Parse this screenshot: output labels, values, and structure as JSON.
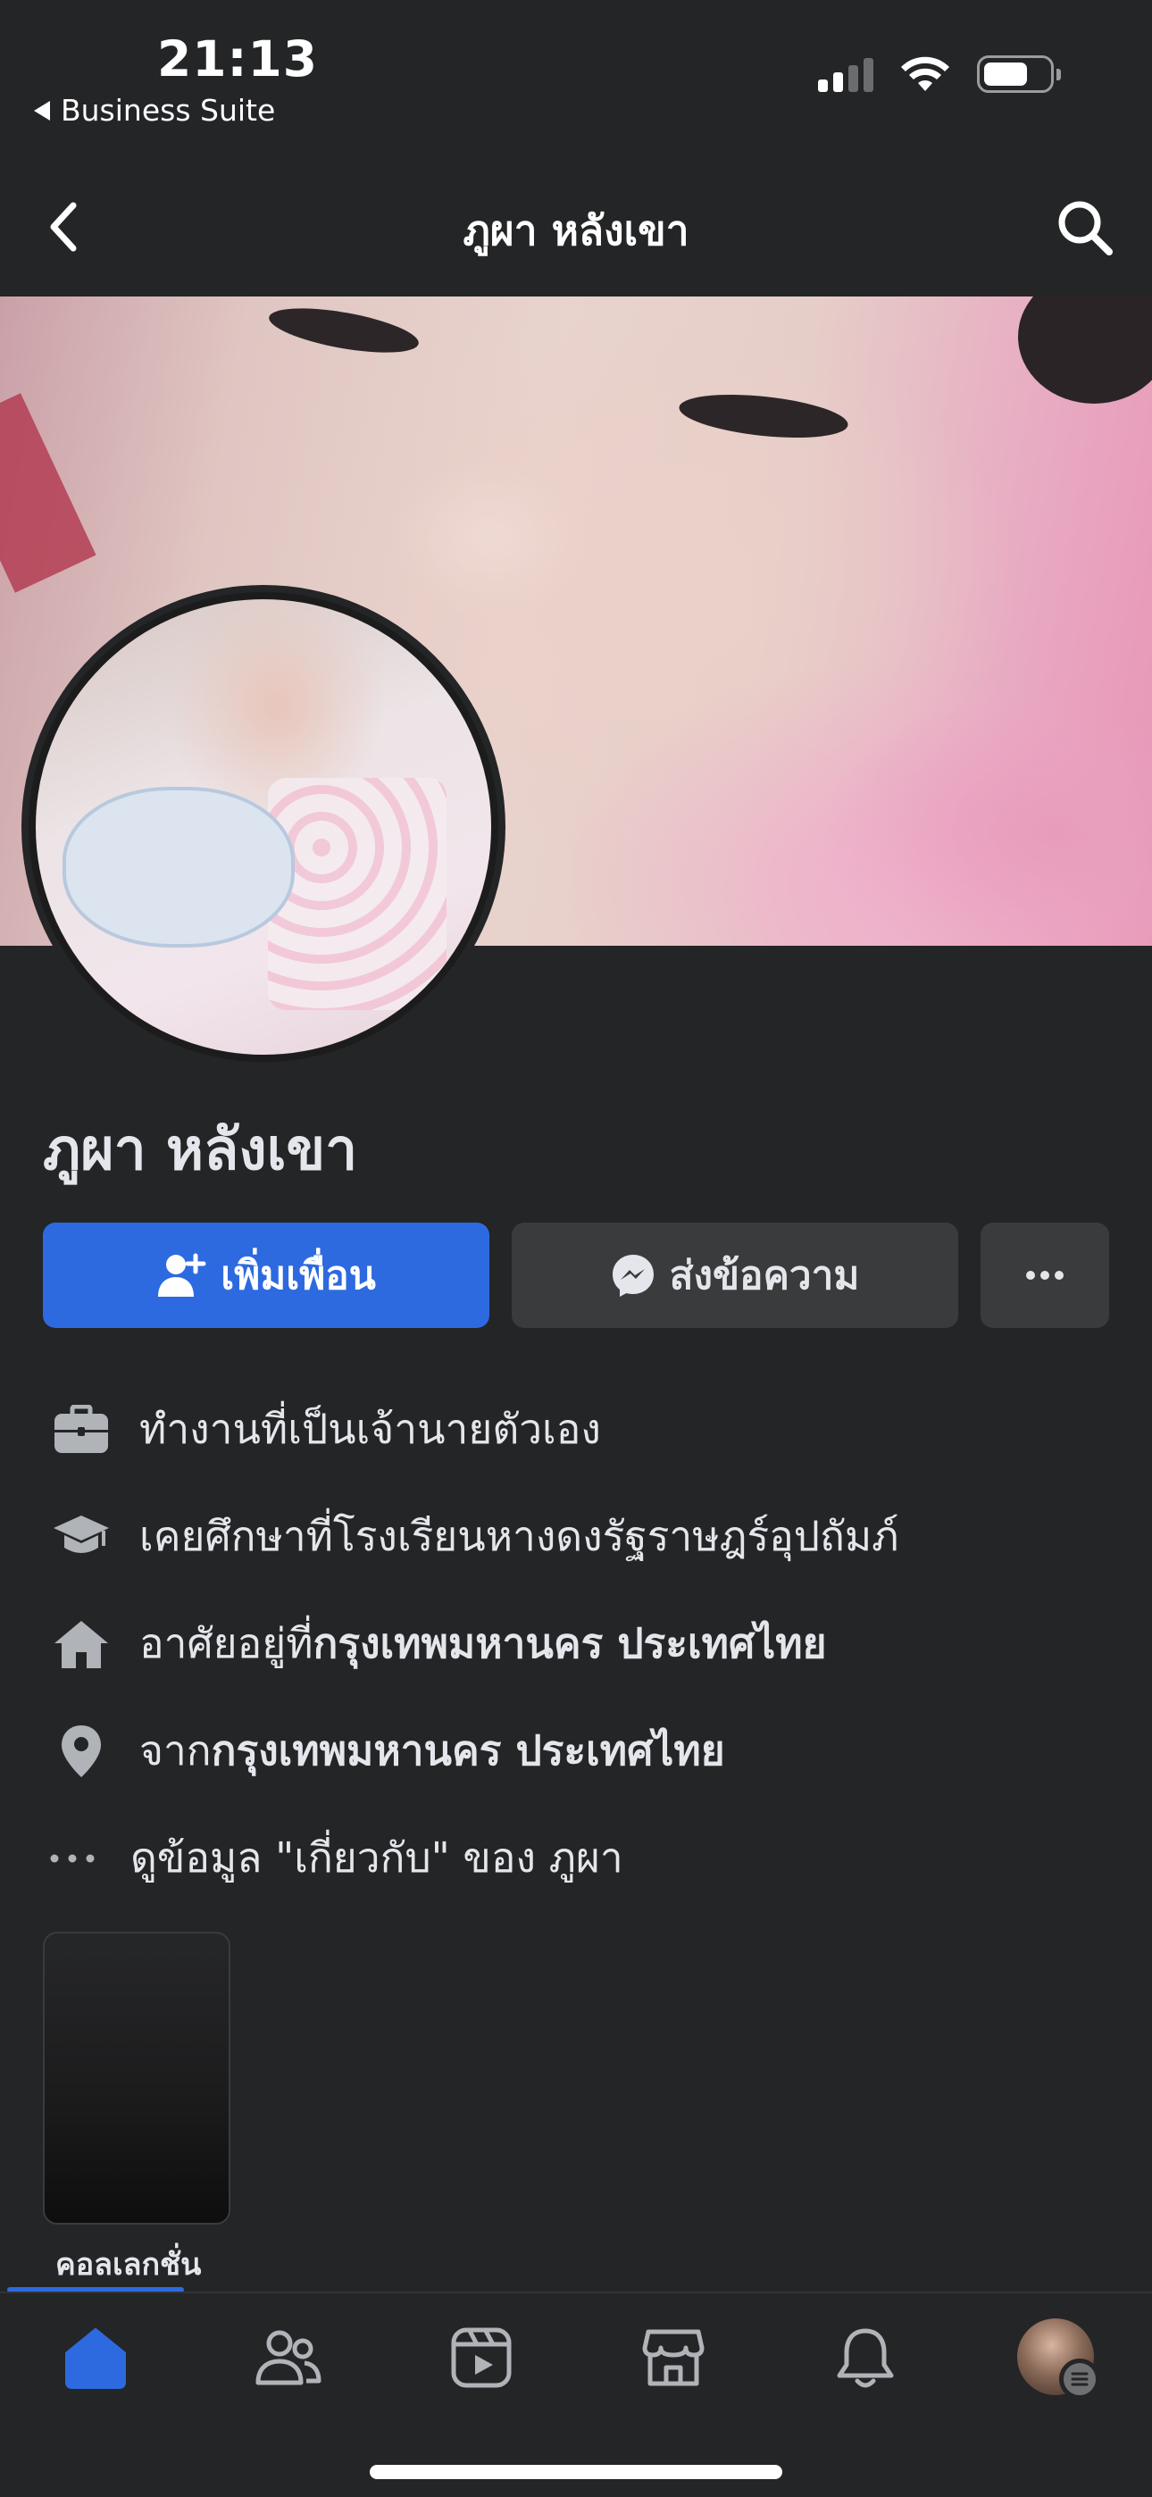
{
  "status_bar": {
    "time": "21:13",
    "back_app": "Business Suite",
    "icons": [
      "cellular-signal-icon",
      "wifi-icon",
      "battery-icon"
    ]
  },
  "nav": {
    "title": "ภูผา หลังเขา",
    "icons": [
      "chevron-left-icon",
      "search-icon"
    ]
  },
  "profile": {
    "name": "ภูผา หลังเขา"
  },
  "actions": {
    "add_friend": "เพิ่มเพื่อน",
    "message": "ส่งข้อความ",
    "more": "..."
  },
  "info": [
    {
      "icon": "briefcase-icon",
      "prefix": "ทำงานที่ ",
      "value": "เป็นเจ้านายตัวเอง",
      "value_bold": false
    },
    {
      "icon": "graduation-cap-icon",
      "prefix": "เคยศึกษาที่ ",
      "value": "โรงเรียนหางดงรัฐราษฎร์อุปถัมภ์",
      "value_bold": false
    },
    {
      "icon": "home-icon",
      "prefix": "อาศัยอยู่ที่ ",
      "value": "กรุงเทพมหานคร ประเทศไทย",
      "value_bold": true
    },
    {
      "icon": "location-pin-icon",
      "prefix": "จาก ",
      "value": "กรุงเทพมหานคร ประเทศไทย",
      "value_bold": true
    }
  ],
  "about_link": "ดูข้อมูล \"เกี่ยวกับ\" ของ ภูผา",
  "collection": {
    "label": "คอลเลกชั่น"
  },
  "tabbar": {
    "items": [
      "home-icon",
      "friends-icon",
      "video-icon",
      "marketplace-icon",
      "bell-icon",
      "profile-avatar"
    ],
    "active": "home-icon",
    "accent": "#2d6ae0"
  },
  "colors": {
    "background": "#242526",
    "accent": "#2d6ae0",
    "secondary_button": "#3a3b3c"
  }
}
